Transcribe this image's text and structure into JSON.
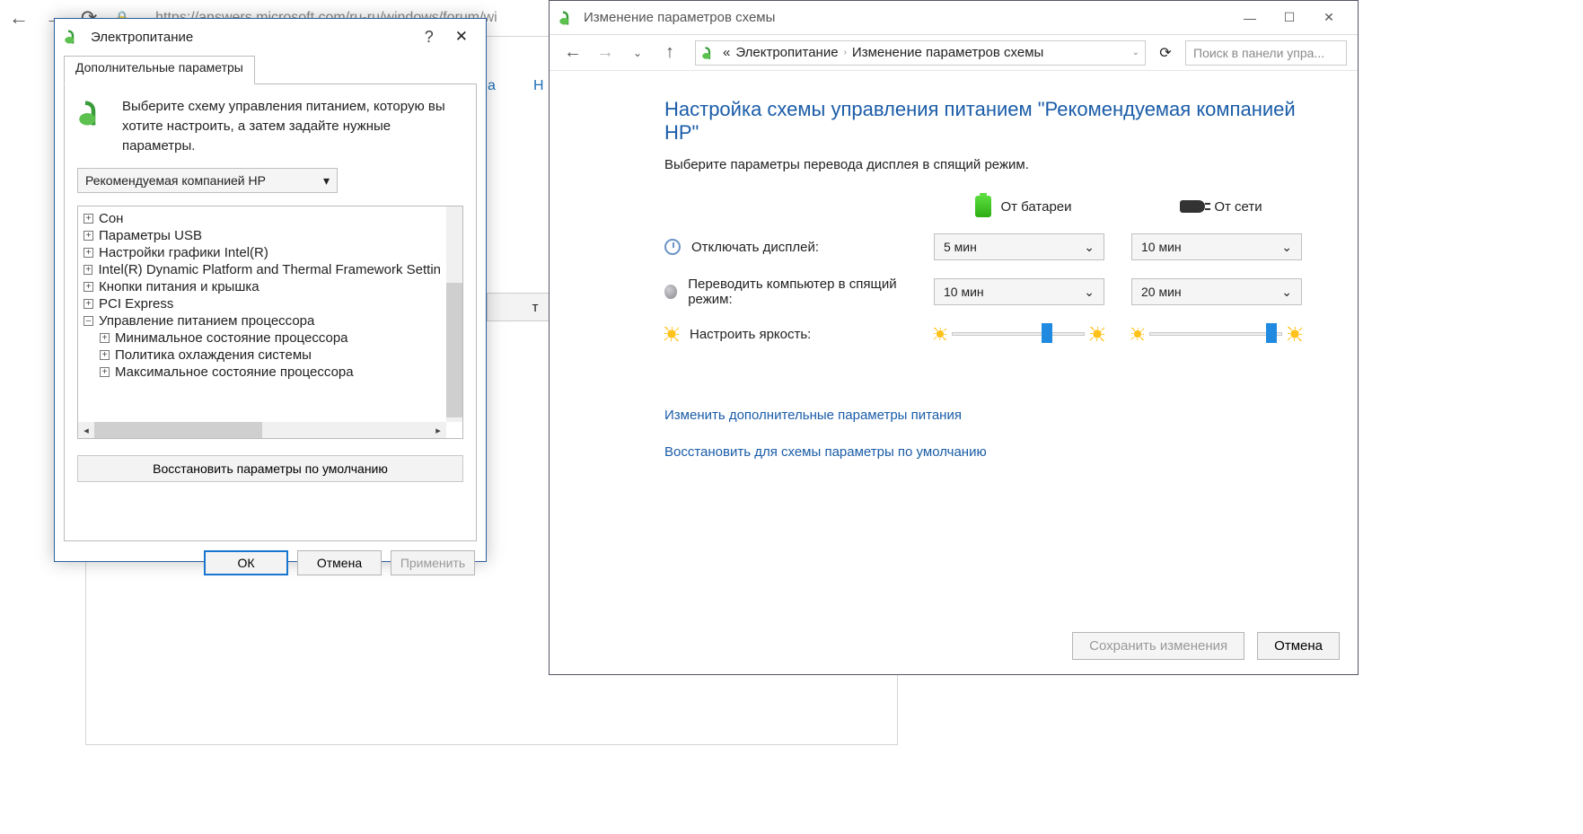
{
  "browser": {
    "url": "https://answers.microsoft.com/ru-ru/windows/forum/wi"
  },
  "behind": {
    "tab1": "а",
    "tab2": "Н",
    "button": "т"
  },
  "dialog": {
    "title": "Электропитание",
    "tab": "Дополнительные параметры",
    "description": "Выберите схему управления питанием, которую вы хотите настроить, а затем задайте нужные параметры.",
    "scheme_selected": "Рекомендуемая компанией HP",
    "tree": [
      "Сон",
      "Параметры USB",
      "Настройки графики Intel(R)",
      "Intel(R) Dynamic Platform and Thermal Framework Settin",
      "Кнопки питания и крышка",
      "PCI Express",
      "Управление питанием процессора",
      "Минимальное состояние процессора",
      "Политика охлаждения системы",
      "Максимальное состояние процессора"
    ],
    "restore": "Восстановить параметры по умолчанию",
    "ok": "ОК",
    "cancel": "Отмена",
    "apply": "Применить"
  },
  "window": {
    "title": "Изменение параметров схемы",
    "breadcrumb": {
      "a": "Электропитание",
      "b": "Изменение параметров схемы"
    },
    "search_placeholder": "Поиск в панели упра...",
    "heading": "Настройка схемы управления питанием \"Рекомендуемая компанией HP\"",
    "subheading": "Выберите параметры перевода дисплея в спящий режим.",
    "col_battery": "От батареи",
    "col_ac": "От сети",
    "row_display": "Отключать дисплей:",
    "row_sleep": "Переводить компьютер в спящий режим:",
    "row_brightness": "Настроить яркость:",
    "values": {
      "display_bat": "5 мин",
      "display_ac": "10 мин",
      "sleep_bat": "10 мин",
      "sleep_ac": "20 мин"
    },
    "link_advanced": "Изменить дополнительные параметры питания",
    "link_restore": "Восстановить для схемы параметры по умолчанию",
    "save": "Сохранить изменения",
    "cancel": "Отмена"
  }
}
